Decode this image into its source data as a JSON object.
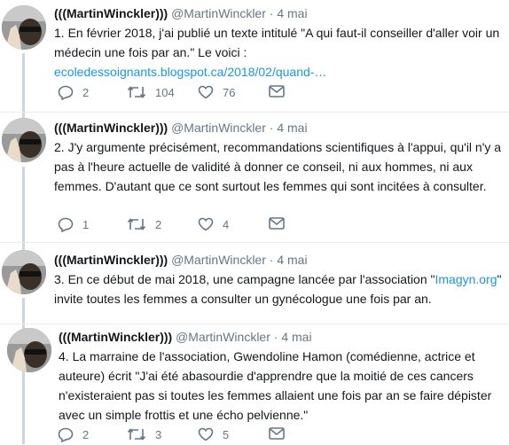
{
  "tweets": [
    {
      "name": "(((MartinWinckler)))",
      "handle": "@MartinWinckler",
      "dot": "·",
      "date": "4 mai",
      "text": "1. En février 2018, j'ai publié un texte intitulé \"A qui faut-il conseiller d'aller voir un médecin une fois par an.\" Le voici :",
      "link": "ecoledessoignants.blogspot.ca/2018/02/quand-…",
      "replies": "2",
      "retweets": "104",
      "likes": "76"
    },
    {
      "name": "(((MartinWinckler)))",
      "handle": "@MartinWinckler",
      "dot": "·",
      "date": "4 mai",
      "text": "2. J'y argumente précisément, recommandations scientifiques à l'appui, qu'il n'y a pas à l'heure actuelle de validité à donner ce conseil, ni aux hommes, ni aux femmes. D'autant que ce sont surtout les femmes qui sont incitées à consulter.",
      "replies": "1",
      "retweets": "2",
      "likes": "4"
    },
    {
      "name": "(((MartinWinckler)))",
      "handle": "@MartinWinckler",
      "dot": "·",
      "date": "4 mai",
      "text_before": "3. En ce début de mai 2018, une campagne lancée par l'association \"",
      "link": "Imagyn.org",
      "text_after": "\" invite toutes les femmes a consulter un gynécologue une fois par an."
    },
    {
      "name": "(((MartinWinckler)))",
      "handle": "@MartinWinckler",
      "dot": "·",
      "date": "4 mai",
      "text": "4. La marraine de l'association, Gwendoline Hamon (comédienne, actrice et auteure) écrit \"J'ai été abasourdie d'apprendre que la moitié de ces cancers n'existeraient pas si toutes les femmes allaient une fois par an se faire dépister avec un simple frottis et une écho pelvienne.\"",
      "replies": "2",
      "retweets": "3",
      "likes": "5"
    }
  ],
  "icons": {
    "reply": "reply-icon",
    "retweet": "retweet-icon",
    "like": "heart-icon",
    "message": "mail-icon"
  },
  "colors": {
    "link": "#1b95e0",
    "muted": "#657786",
    "thread_line": "#cdd5dd"
  }
}
